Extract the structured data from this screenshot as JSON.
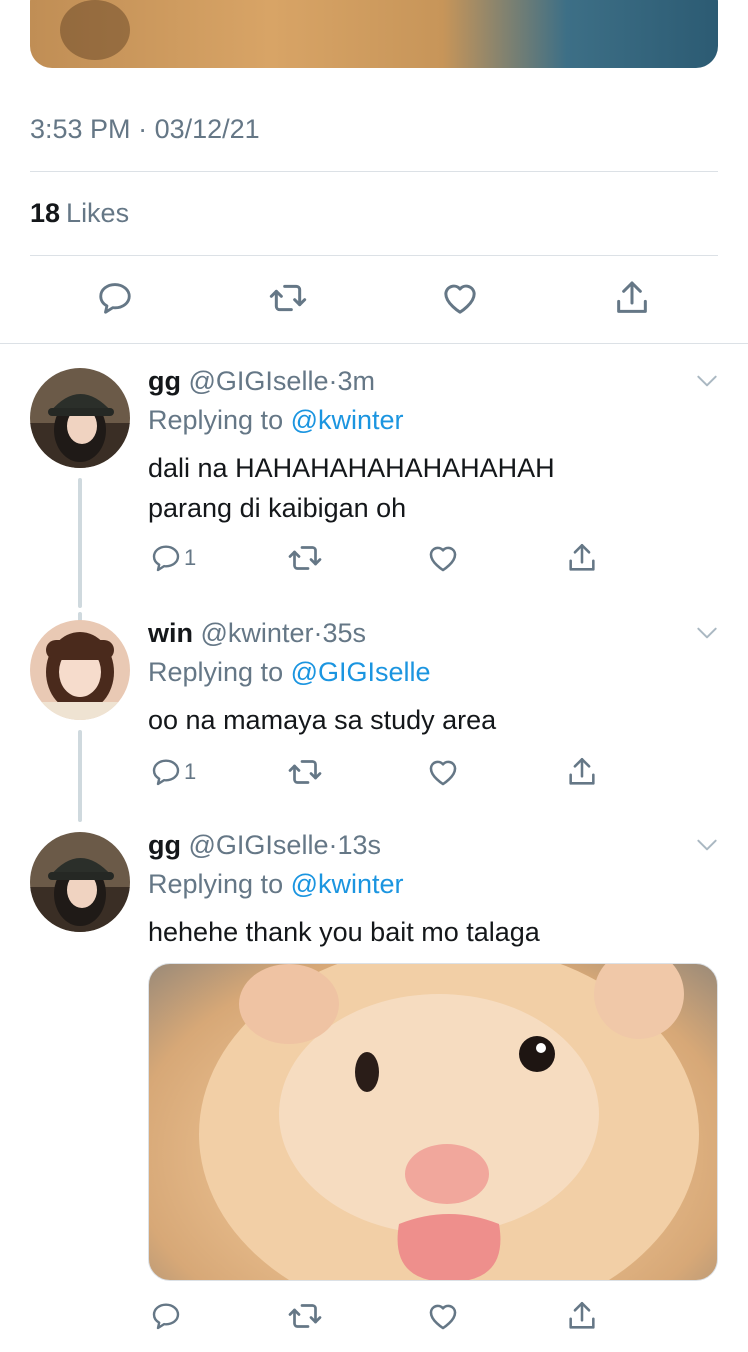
{
  "tweet": {
    "time": "3:53 PM",
    "separator": "·",
    "date": "03/12/21",
    "likes_count": "18",
    "likes_label": "Likes"
  },
  "replies": [
    {
      "name": "gg",
      "handle": "@GIGIselle",
      "separator": "·",
      "time": "3m",
      "replying_prefix": "Replying to",
      "replying_to": "@kwinter",
      "text_line1": "dali na HAHAHAHAHAHAHAHAH",
      "text_line2": "parang di kaibigan oh",
      "reply_count": "1"
    },
    {
      "name": "win",
      "handle": "@kwinter",
      "separator": "·",
      "time": "35s",
      "replying_prefix": "Replying to",
      "replying_to": "@GIGIselle",
      "text_line1": "oo na mamaya sa study area",
      "reply_count": "1"
    },
    {
      "name": "gg",
      "handle": "@GIGIselle",
      "separator": "·",
      "time": "13s",
      "replying_prefix": "Replying to",
      "replying_to": "@kwinter",
      "text_line1": "hehehe thank you bait mo talaga"
    }
  ],
  "icons": [
    "reply-icon",
    "retweet-icon",
    "like-icon",
    "share-icon",
    "chevron-down-icon"
  ],
  "colors": {
    "link": "#1b95e0",
    "secondary": "#657786",
    "divider": "#dce1e6"
  }
}
